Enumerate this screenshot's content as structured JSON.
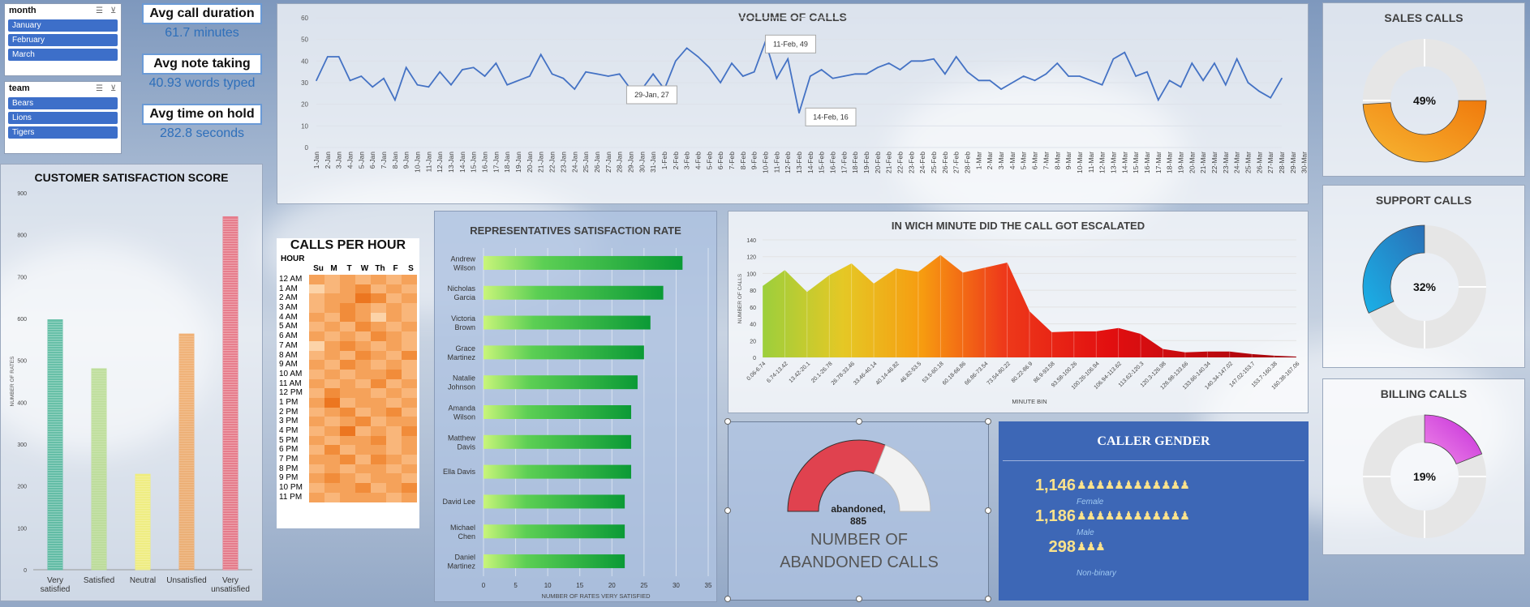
{
  "slicers": {
    "month": {
      "header": "month",
      "items": [
        "January",
        "February",
        "March"
      ]
    },
    "team": {
      "header": "team",
      "items": [
        "Bears",
        "Lions",
        "Tigers"
      ]
    }
  },
  "kpis": [
    {
      "label": "Avg call duration",
      "value": "61.7 minutes"
    },
    {
      "label": "Avg note taking",
      "value": "40.93 words typed"
    },
    {
      "label": "Avg time on hold",
      "value": "282.8 seconds"
    }
  ],
  "volume": {
    "title": "VOLUME OF CALLS",
    "annotations": [
      "11-Feb, 49",
      "29-Jan, 27",
      "14-Feb, 16"
    ],
    "chart_data": {
      "type": "line",
      "yticks": [
        0,
        10,
        20,
        30,
        40,
        50,
        60
      ],
      "ylim": [
        0,
        60
      ],
      "x": [
        "1-Jan",
        "2-Jan",
        "3-Jan",
        "4-Jan",
        "5-Jan",
        "6-Jan",
        "7-Jan",
        "8-Jan",
        "9-Jan",
        "10-Jan",
        "11-Jan",
        "12-Jan",
        "13-Jan",
        "14-Jan",
        "15-Jan",
        "16-Jan",
        "17-Jan",
        "18-Jan",
        "19-Jan",
        "20-Jan",
        "21-Jan",
        "22-Jan",
        "23-Jan",
        "24-Jan",
        "25-Jan",
        "26-Jan",
        "27-Jan",
        "28-Jan",
        "29-Jan",
        "30-Jan",
        "31-Jan",
        "1-Feb",
        "2-Feb",
        "3-Feb",
        "4-Feb",
        "5-Feb",
        "6-Feb",
        "7-Feb",
        "8-Feb",
        "9-Feb",
        "10-Feb",
        "11-Feb",
        "12-Feb",
        "13-Feb",
        "14-Feb",
        "15-Feb",
        "16-Feb",
        "17-Feb",
        "18-Feb",
        "19-Feb",
        "20-Feb",
        "21-Feb",
        "22-Feb",
        "23-Feb",
        "24-Feb",
        "25-Feb",
        "26-Feb",
        "27-Feb",
        "28-Feb",
        "1-Mar",
        "2-Mar",
        "3-Mar",
        "4-Mar",
        "5-Mar",
        "6-Mar",
        "7-Mar",
        "8-Mar",
        "9-Mar",
        "10-Mar",
        "11-Mar",
        "12-Mar",
        "13-Mar",
        "14-Mar",
        "15-Mar",
        "16-Mar",
        "17-Mar",
        "18-Mar",
        "19-Mar",
        "20-Mar",
        "21-Mar",
        "22-Mar",
        "23-Mar",
        "24-Mar",
        "25-Mar",
        "26-Mar",
        "27-Mar",
        "28-Mar",
        "29-Mar",
        "30-Mar"
      ],
      "values": [
        31,
        42,
        42,
        31,
        33,
        28,
        32,
        22,
        37,
        29,
        28,
        35,
        29,
        36,
        37,
        33,
        39,
        29,
        31,
        33,
        43,
        34,
        32,
        27,
        35,
        34,
        33,
        34,
        27,
        27,
        34,
        27,
        40,
        46,
        42,
        37,
        30,
        39,
        33,
        35,
        49,
        32,
        41,
        16,
        33,
        36,
        32,
        33,
        34,
        34,
        37,
        39,
        36,
        40,
        40,
        41,
        34,
        42,
        35,
        31,
        31,
        27,
        30,
        33,
        31,
        34,
        39,
        33,
        33,
        31,
        29,
        41,
        44,
        33,
        35,
        22,
        31,
        28,
        39,
        31,
        39,
        29,
        41,
        30,
        26,
        23,
        32
      ]
    }
  },
  "csat": {
    "title": "CUSTOMER SATISFACTION SCORE",
    "ylabel": "NUMBER OF RATES",
    "chart_data": {
      "type": "bar",
      "categories": [
        "Very satisfied",
        "Satisfied",
        "Neutral",
        "Unsatisfied",
        "Very unsatisfied"
      ],
      "values": [
        597,
        480,
        228,
        563,
        843
      ],
      "ylim": [
        0,
        900
      ],
      "yticks": [
        0,
        100,
        200,
        300,
        400,
        500,
        600,
        700,
        800,
        900
      ],
      "colors": [
        "#4fb79a",
        "#b6db8b",
        "#f3f06c",
        "#f0a55e",
        "#e86c7c"
      ]
    }
  },
  "cph": {
    "title": "CALLS PER HOUR",
    "corner": "HOUR",
    "days": [
      "Su",
      "M",
      "T",
      "W",
      "Th",
      "F",
      "S"
    ],
    "hours": [
      "12 AM",
      "1 AM",
      "2 AM",
      "3 AM",
      "4 AM",
      "5 AM",
      "6 AM",
      "7 AM",
      "8 AM",
      "9 AM",
      "10 AM",
      "11 AM",
      "12 PM",
      "1 PM",
      "2 PM",
      "3 PM",
      "4 PM",
      "5 PM",
      "6 PM",
      "7 PM",
      "8 PM",
      "9 PM",
      "10 PM",
      "11 PM"
    ],
    "chart_data": {
      "type": "heatmap",
      "levels": [
        [
          3,
          2,
          3,
          2,
          3,
          2,
          3
        ],
        [
          1,
          2,
          3,
          4,
          2,
          3,
          2
        ],
        [
          2,
          3,
          3,
          5,
          4,
          2,
          3
        ],
        [
          2,
          3,
          4,
          3,
          2,
          3,
          2
        ],
        [
          3,
          2,
          4,
          3,
          1,
          3,
          2
        ],
        [
          2,
          3,
          2,
          4,
          3,
          2,
          3
        ],
        [
          3,
          2,
          3,
          2,
          4,
          3,
          2
        ],
        [
          1,
          3,
          4,
          3,
          2,
          3,
          2
        ],
        [
          2,
          3,
          2,
          4,
          3,
          2,
          4
        ],
        [
          3,
          2,
          4,
          3,
          2,
          3,
          2
        ],
        [
          2,
          3,
          2,
          3,
          3,
          4,
          2
        ],
        [
          3,
          2,
          3,
          2,
          4,
          2,
          3
        ],
        [
          2,
          4,
          3,
          3,
          2,
          3,
          2
        ],
        [
          3,
          5,
          2,
          3,
          3,
          2,
          3
        ],
        [
          2,
          3,
          4,
          2,
          3,
          4,
          2
        ],
        [
          3,
          2,
          3,
          4,
          2,
          3,
          3
        ],
        [
          2,
          3,
          5,
          2,
          3,
          2,
          4
        ],
        [
          3,
          2,
          3,
          3,
          4,
          2,
          3
        ],
        [
          2,
          4,
          2,
          3,
          3,
          2,
          3
        ],
        [
          3,
          3,
          4,
          2,
          4,
          3,
          2
        ],
        [
          2,
          3,
          2,
          3,
          3,
          2,
          3
        ],
        [
          3,
          4,
          3,
          2,
          3,
          3,
          2
        ],
        [
          2,
          3,
          3,
          4,
          2,
          3,
          4
        ],
        [
          3,
          2,
          3,
          3,
          3,
          2,
          3
        ]
      ]
    }
  },
  "reps": {
    "title": "REPRESENTATIVES SATISFACTION RATE",
    "xlabel": "NUMBER OF RATES VERY SATISFIED",
    "chart_data": {
      "type": "bar",
      "categories": [
        "Andrew Wilson",
        "Nicholas Garcia",
        "Victoria Brown",
        "Grace Martinez",
        "Natalie Johnson",
        "Amanda Wilson",
        "Matthew Davis",
        "Ella Davis",
        "David Lee",
        "Michael Chen",
        "Daniel Martinez"
      ],
      "values": [
        31,
        28,
        26,
        25,
        24,
        23,
        23,
        23,
        22,
        22,
        22
      ],
      "xticks": [
        0,
        5,
        10,
        15,
        20,
        25,
        30,
        35
      ],
      "xlim": [
        0,
        35
      ]
    }
  },
  "escalation": {
    "title": "IN WICH MINUTE DID THE CALL GOT ESCALATED",
    "ylabel": "NUMBER OF CALLS",
    "xlabel": "MINUTE BIN",
    "chart_data": {
      "type": "area",
      "yticks": [
        0,
        20,
        40,
        60,
        80,
        100,
        120,
        140
      ],
      "ylim": [
        0,
        140
      ],
      "x": [
        "0.06-6.74",
        "6.74-13.42",
        "13.42-20.1",
        "20.1-26.78",
        "26.78-33.46",
        "33.46-40.14",
        "40.14-46.82",
        "46.82-53.5",
        "53.5-60.18",
        "60.18-66.86",
        "66.86-73.54",
        "73.54-80.22",
        "80.22-86.9",
        "86.9-93.58",
        "93.58-100.26",
        "100.26-106.94",
        "106.94-113.62",
        "113.62-120.3",
        "120.3-126.98",
        "126.98-133.66",
        "133.66-140.34",
        "140.34-147.02",
        "147.02-153.7",
        "153.7-160.38",
        "160.38-167.06"
      ],
      "values": [
        85,
        104,
        78,
        98,
        112,
        88,
        106,
        102,
        122,
        101,
        107,
        113,
        55,
        30,
        31,
        31,
        35,
        28,
        10,
        6,
        7,
        7,
        4,
        2,
        1
      ]
    }
  },
  "abandoned": {
    "label": "abandoned,",
    "value": "885",
    "caption1": "NUMBER OF",
    "caption2": "ABANDONED CALLS",
    "fraction": 0.62
  },
  "gender": {
    "title": "CALLER GENDER",
    "rows": [
      {
        "count": "1,146",
        "label": "Female",
        "icons": 12
      },
      {
        "count": "1,186",
        "label": "Male",
        "icons": 12
      },
      {
        "count": "298",
        "label": "Non-binary",
        "icons": 3
      }
    ]
  },
  "donuts": [
    {
      "title": "SALES CALLS",
      "pct": "49%",
      "value": 0.49,
      "colors": [
        "#f7b733",
        "#f07a0c"
      ]
    },
    {
      "title": "SUPPORT CALLS",
      "pct": "32%",
      "value": 0.32,
      "colors": [
        "#1ab2e8",
        "#2a6fb6"
      ]
    },
    {
      "title": "BILLING CALLS",
      "pct": "19%",
      "value": 0.19,
      "colors": [
        "#f08ae8",
        "#c42bd9"
      ]
    }
  ]
}
